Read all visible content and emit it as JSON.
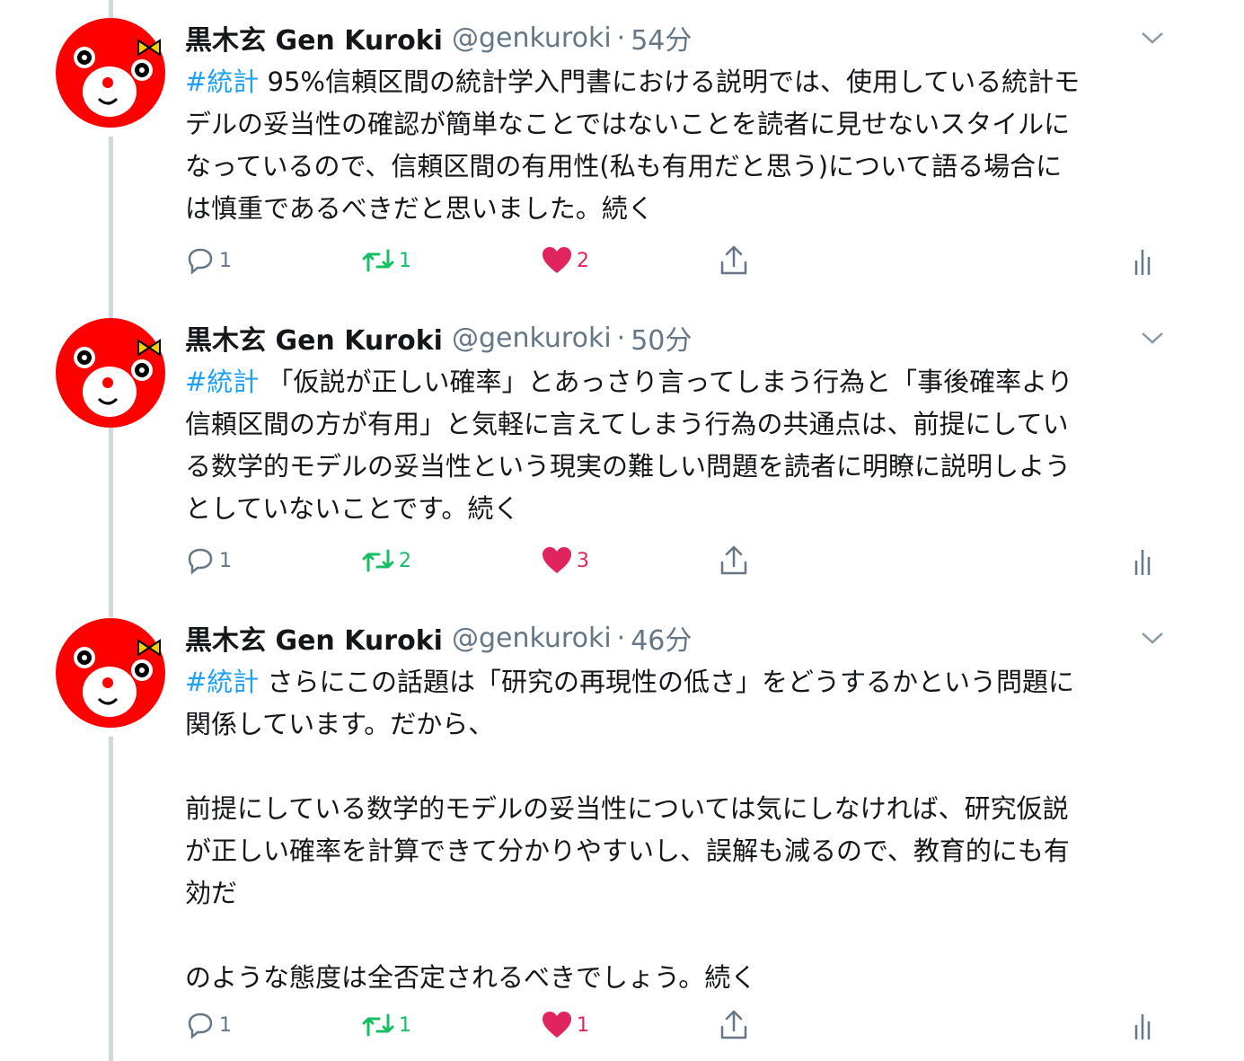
{
  "tweets": [
    {
      "name": "黒木玄 Gen Kuroki",
      "handle": "@genkuroki",
      "separator": "·",
      "time": "54分",
      "hashtag": "#統計",
      "text_lines": [
        " 95%信頼区間の統計学入門書における説明では、使用している統計モ",
        "デルの妥当性の確認が簡単なことではないことを読者に見せないスタイルに",
        "なっているので、信頼区間の有用性(私も有用だと思う)について語る場合に",
        "は慎重であるべきだと思いました。続く"
      ],
      "replies": "1",
      "retweets": "1",
      "likes": "2"
    },
    {
      "name": "黒木玄 Gen Kuroki",
      "handle": "@genkuroki",
      "separator": "·",
      "time": "50分",
      "hashtag": "#統計",
      "text_lines": [
        " 「仮説が正しい確率」とあっさり言ってしまう行為と「事後確率より",
        "信頼区間の方が有用」と気軽に言えてしまう行為の共通点は、前提にしてい",
        "る数学的モデルの妥当性という現実の難しい問題を読者に明瞭に説明しよう",
        "としていないことです。続く"
      ],
      "replies": "1",
      "retweets": "2",
      "likes": "3"
    },
    {
      "name": "黒木玄 Gen Kuroki",
      "handle": "@genkuroki",
      "separator": "·",
      "time": "46分",
      "hashtag": "#統計",
      "text_lines": [
        " さらにこの話題は「研究の再現性の低さ」をどうするかという問題に",
        "関係しています。だから、",
        "",
        "前提にしている数学的モデルの妥当性については気にしなければ、研究仮説",
        "が正しい確率を計算できて分かりやすいし、誤解も減るので、教育的にも有",
        "効だ",
        "",
        "のような態度は全否定されるべきでしょう。続く"
      ],
      "replies": "1",
      "retweets": "1",
      "likes": "1"
    }
  ],
  "icons": {
    "avatar": "red-mascot-avatar",
    "reply": "reply-icon",
    "retweet": "retweet-icon",
    "like": "heart-icon",
    "share": "share-icon",
    "analytics": "analytics-icon",
    "more": "chevron-down-icon"
  },
  "colors": {
    "hashtag": "#1da1f2",
    "retweet": "#17bf63",
    "like": "#e0245e",
    "muted": "#657786",
    "avatar_bg": "#ff0000"
  }
}
